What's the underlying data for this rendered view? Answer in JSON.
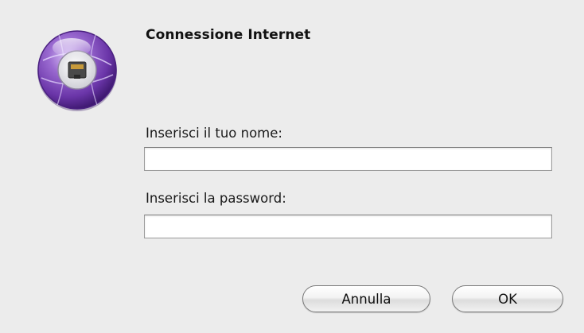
{
  "dialog": {
    "title": "Connessione Internet",
    "icon": "network-port-icon",
    "accent_color": "#7b4bb8"
  },
  "form": {
    "name_label": "Inserisci il tuo nome:",
    "name_value": "",
    "password_label": "Inserisci la password:",
    "password_value": ""
  },
  "buttons": {
    "cancel_label": "Annulla",
    "ok_label": "OK"
  }
}
